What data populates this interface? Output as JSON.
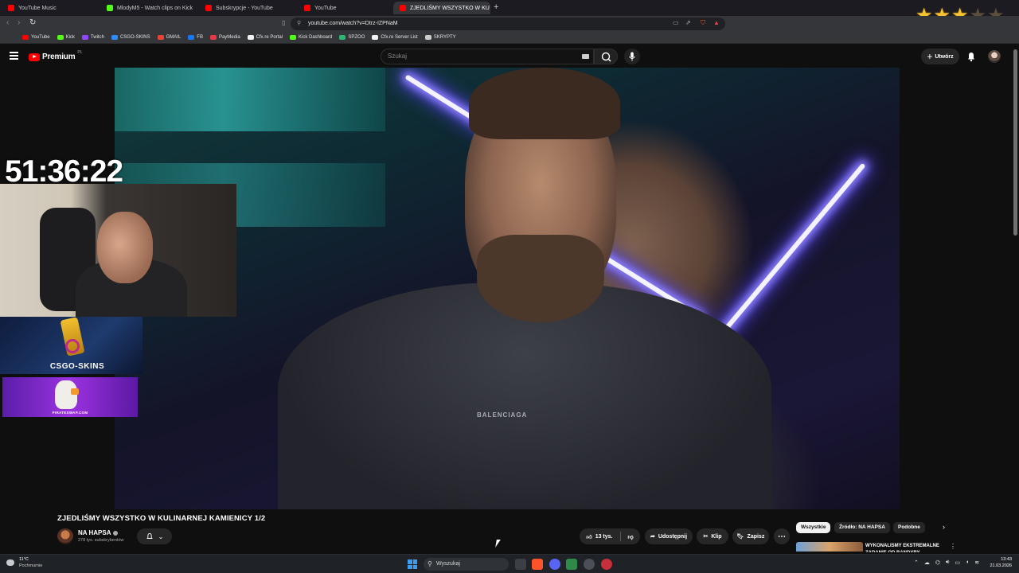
{
  "browser": {
    "tabs": [
      {
        "label": "YouTube Music",
        "favicon": "youtube-music"
      },
      {
        "label": "MlodyM5 - Watch clips on Kick",
        "favicon": "kick"
      },
      {
        "label": "Subskrypcje - YouTube",
        "favicon": "youtube"
      },
      {
        "label": "YouTube",
        "favicon": "youtube"
      },
      {
        "label": "ZJEDLIŚMY WSZYSTKO W KU",
        "favicon": "youtube",
        "active": true
      }
    ],
    "new_tab_label": "+",
    "url": "youtube.com/watch?v=Dtrz-IZPNaM",
    "bookmarks": [
      {
        "label": "YouTube",
        "color": "#ff0000"
      },
      {
        "label": "Kick",
        "color": "#53fc18"
      },
      {
        "label": "Twitch",
        "color": "#9146ff"
      },
      {
        "label": "CSGO-SKINS",
        "color": "#2d8cff"
      },
      {
        "label": "GMAIL",
        "color": "#ea4335"
      },
      {
        "label": "FB",
        "color": "#1877f2"
      },
      {
        "label": "PayMedia",
        "color": "#e63946"
      },
      {
        "label": "Cfx.re Portal",
        "color": "#f2f2f2"
      },
      {
        "label": "Kick Dashboard",
        "color": "#53fc18"
      },
      {
        "label": "SPZOO",
        "color": "#2bb673"
      },
      {
        "label": "Cfx.re Server List",
        "color": "#f2f2f2"
      },
      {
        "label": "SKRYPTY",
        "color": "#cccccc"
      }
    ]
  },
  "overlay_rating": {
    "filled": 3,
    "total": 5
  },
  "youtube": {
    "logo_text": "Premium",
    "logo_country": "PL",
    "search_placeholder": "Szukaj",
    "create_label": "Utwórz",
    "video": {
      "title": "ZJEDLIŚMY WSZYSTKO W KULINARNEJ KAMIENICY 1/2",
      "shirt_text": "BALENCIAGA",
      "channel_name": "NA HAPSA",
      "subscribers": "278 tys. subskrybentów",
      "likes": "13 tys.",
      "share_label": "Udostępnij",
      "clip_label": "Klip",
      "save_label": "Zapisz"
    },
    "chips": [
      "Wszystkie",
      "Źródło: NA HAPSA",
      "Podobne"
    ],
    "recommendation": {
      "title": "WYKONALIŚMY EKSTREMALNE ZADANIE OD BANDYRY"
    }
  },
  "stream_overlay": {
    "timer": "51:36:22",
    "sponsor_1": "CSGO-SKINS",
    "sponsor_2": "PIRATESWAP.COM"
  },
  "taskbar": {
    "temperature": "11°C",
    "weather": "Pochmurnie",
    "search_label": "Wyszukaj",
    "time": "13:43",
    "date": "21.03.2026"
  }
}
